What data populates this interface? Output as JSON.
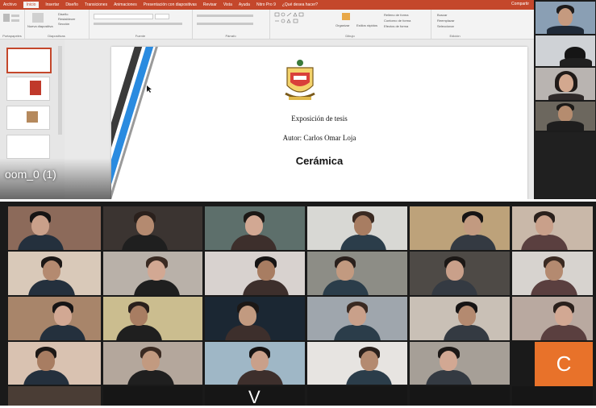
{
  "ribbon": {
    "tabs": [
      "Archivo",
      "Inicio",
      "Insertar",
      "Diseño",
      "Transiciones",
      "Animaciones",
      "Presentación con diapositivas",
      "Revisar",
      "Vista",
      "Ayuda",
      "Nitro Pro 9",
      "¿Qué desea hacer?"
    ],
    "active_tab": "Inicio",
    "share": "Compartir",
    "groups": [
      "Portapapeles",
      "Diapositivas",
      "Fuente",
      "Párrafo",
      "Dibujo",
      "Edición"
    ],
    "new_slide": "Nueva diapositiva",
    "layout": "Diseño",
    "reset": "Restablecer",
    "section": "Sección",
    "arrange": "Organizar",
    "quick_styles": "Estilos rápidos",
    "shape_fill": "Relleno de forma",
    "shape_outline": "Contorno de forma",
    "shape_effects": "Efectos de forma",
    "find": "Buscar",
    "replace": "Reemplazar",
    "select": "Seleccionar"
  },
  "slide": {
    "title": "Exposición de tesis",
    "author": "Autor:  Carlos Omar Loja",
    "subject": "Cerámica"
  },
  "zoom_label": "oom_0 (1)",
  "avatar_letter": "C",
  "partial_letter": "V",
  "colors": {
    "ribbon_accent": "#c4472b",
    "avatar_orange": "#e8722a",
    "stripe_blue": "#2a8be0",
    "stripe_dark": "#3a3a3a"
  }
}
